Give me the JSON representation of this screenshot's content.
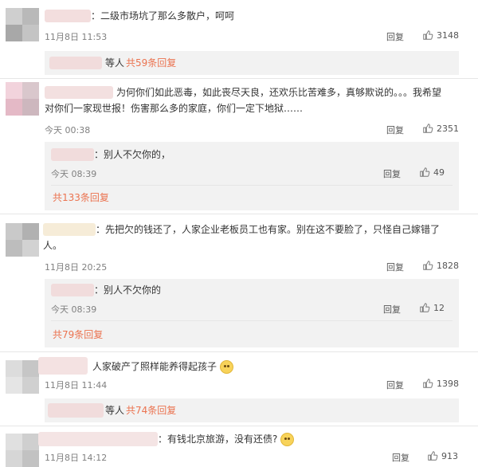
{
  "comments": [
    {
      "text": "：二级市场坑了那么多散户，呵呵",
      "time": "11月8日 11:53",
      "reply_label": "回复",
      "likes": "3148",
      "footer": {
        "prefix": "等人",
        "link": "共59条回复"
      }
    },
    {
      "text_line1": "为何你们如此恶毒，如此丧尽天良，还欢乐比苦难多，真够欺说的。。。我希望",
      "text_line2": "对你们一家现世报！伤害那么多的家庭，你们一定下地狱……",
      "time": "今天 00:38",
      "reply_label": "回复",
      "likes": "2351",
      "sub_reply": {
        "text": "：别人不欠你的，",
        "time": "今天 08:39",
        "reply_label": "回复",
        "likes": "49"
      },
      "footer": {
        "link": "共133条回复"
      }
    },
    {
      "text_line1": "：先把欠的钱还了，人家企业老板员工也有家。别在这不要脸了，只怪自己嫁错了",
      "text_line2": "人。",
      "time": "11月8日 20:25",
      "reply_label": "回复",
      "likes": "1828",
      "sub_reply": {
        "text": "：别人不欠你的",
        "time": "今天 08:39",
        "reply_label": "回复",
        "likes": "12"
      },
      "footer": {
        "link": "共79条回复"
      }
    },
    {
      "text": "人家破产了照样能养得起孩子",
      "emoji": "smile-emoji",
      "time": "11月8日 11:44",
      "reply_label": "回复",
      "likes": "1398",
      "footer": {
        "prefix": "等人",
        "link": "共74条回复"
      }
    },
    {
      "text": "：有钱北京旅游，没有还债?",
      "emoji": "smirk-emoji",
      "time": "11月8日 14:12",
      "reply_label": "回复",
      "likes": "913"
    }
  ],
  "colors": {
    "accent": "#eb7350",
    "reply_bg": "#f2f2f2",
    "meta": "#808080"
  }
}
